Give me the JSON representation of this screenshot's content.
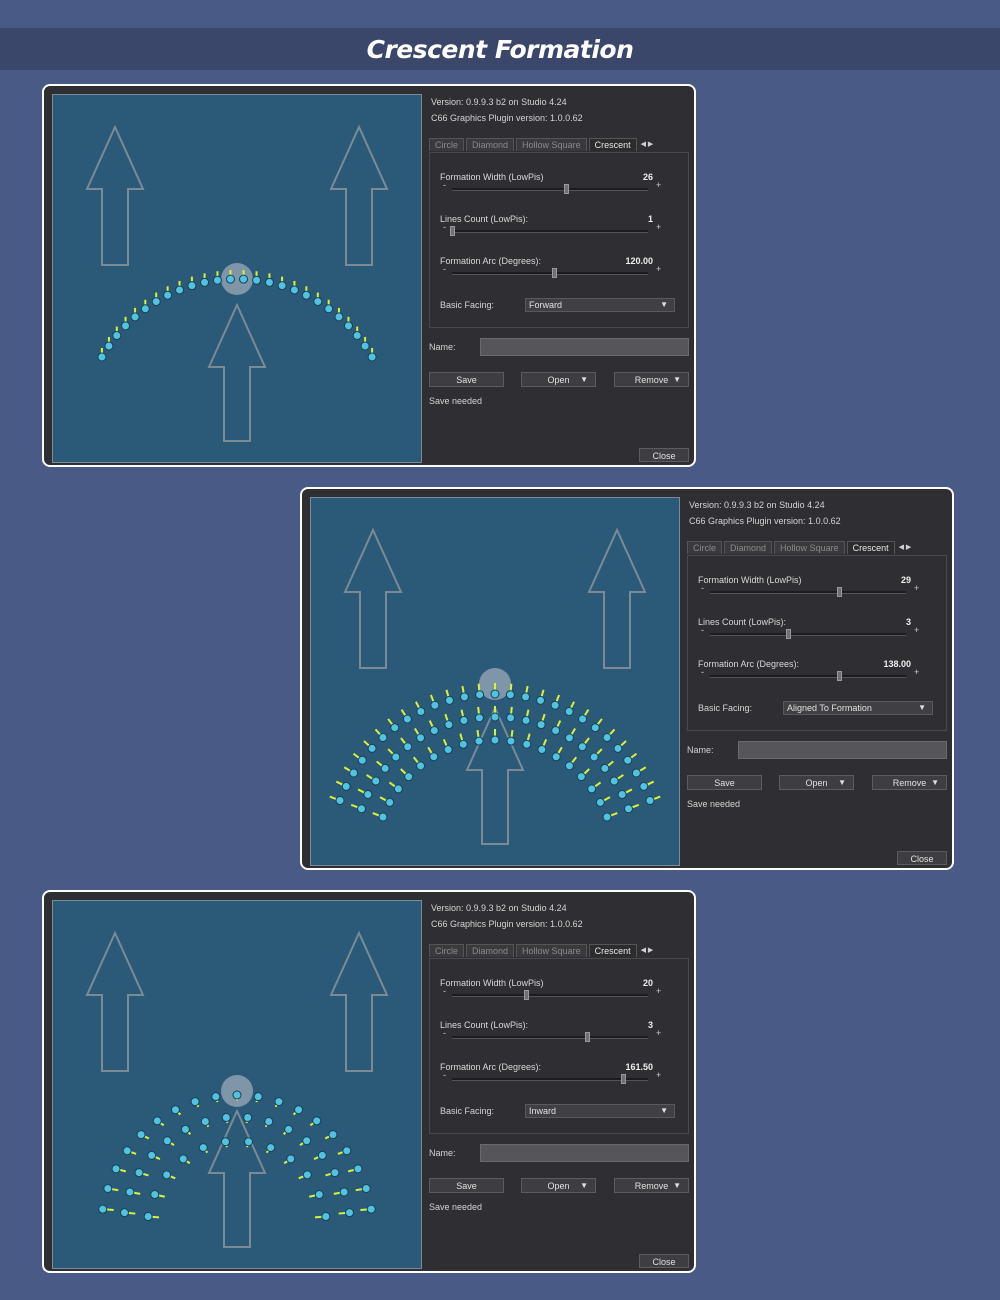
{
  "page_title": "Crescent Formation",
  "common": {
    "version": "Version: 0.9.9.3 b2 on Studio 4.24",
    "plugin_version": "C66 Graphics Plugin version: 1.0.0.62",
    "tabs": [
      "Circle",
      "Diamond",
      "Hollow Square",
      "Crescent"
    ],
    "tab_arrows": "◀ ▶",
    "width_label": "Formation Width (LowPis)",
    "lines_label": "Lines Count (LowPis):",
    "arc_label": "Formation Arc (Degrees):",
    "facing_label": "Basic Facing:",
    "name_label": "Name:",
    "save_label": "Save",
    "open_label": "Open",
    "remove_label": "Remove",
    "save_needed": "Save needed",
    "close_label": "Close",
    "minus": "-",
    "plus": "+"
  },
  "panels": [
    {
      "width_value": "26",
      "lines_value": "1",
      "arc_value": "120.00",
      "facing": "Forward",
      "width_frac": 0.58,
      "lines_frac": 0.0,
      "arc_frac": 0.52
    },
    {
      "width_value": "29",
      "lines_value": "3",
      "arc_value": "138.00",
      "facing": "Aligned To Formation",
      "width_frac": 0.66,
      "lines_frac": 0.4,
      "arc_frac": 0.66
    },
    {
      "width_value": "20",
      "lines_value": "3",
      "arc_value": "161.50",
      "facing": "Inward",
      "width_frac": 0.38,
      "lines_frac": 0.69,
      "arc_frac": 0.87
    }
  ],
  "colors": {
    "background": "#4a5a86",
    "title_bar": "#3a466a",
    "preview_bg": "#2a5a78",
    "unit_fill": "#4fc3e0",
    "unit_facing": "#d8f23a",
    "arrow_outline": "#7a8b96",
    "center_disc": "#7f95a8"
  },
  "icons": {
    "dropdown": "▼",
    "open": "▼",
    "remove": "▼"
  }
}
